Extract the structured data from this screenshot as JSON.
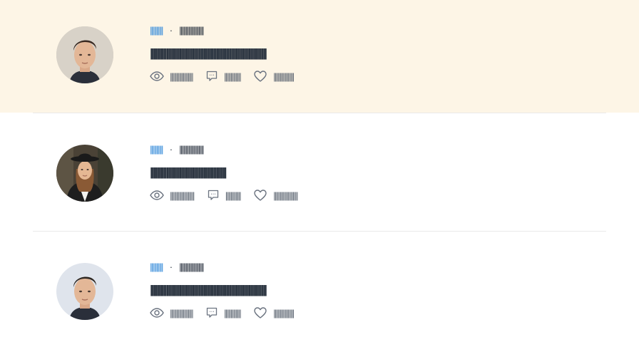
{
  "posts": [
    {
      "author": "||||||||||",
      "date": "|||||||||||||||||||",
      "title": "||||||||||||||||||||||||||||||||||||||||||||||||||||||||||||||||||||||||",
      "views": "||||||||||||||||||",
      "comments": "|||||||||||||",
      "likes": "||||||||||||||||",
      "avatar_icon": "man-portrait",
      "highlight": true
    },
    {
      "author": "||||||||||",
      "date": "|||||||||||||||||||",
      "title": "|||||||||||||||||||||||||||||||||||||||||||||||",
      "views": "|||||||||||||||||||",
      "comments": "||||||||||||",
      "likes": "|||||||||||||||||||",
      "avatar_icon": "woman-portrait",
      "highlight": false
    },
    {
      "author": "||||||||||",
      "date": "|||||||||||||||||||",
      "title": "||||||||||||||||||||||||||||||||||||||||||||||||||||||||||||||||||||||||",
      "views": "||||||||||||||||||",
      "comments": "|||||||||||||",
      "likes": "||||||||||||||||",
      "avatar_icon": "man-portrait",
      "highlight": false
    }
  ],
  "separator": "·",
  "colors": {
    "highlight_bg": "#fdf5e6",
    "author_link": "#3b8fdb",
    "text_dark": "#2b3440",
    "icon_gray": "#6b7380",
    "divider": "#e9e9e9"
  }
}
